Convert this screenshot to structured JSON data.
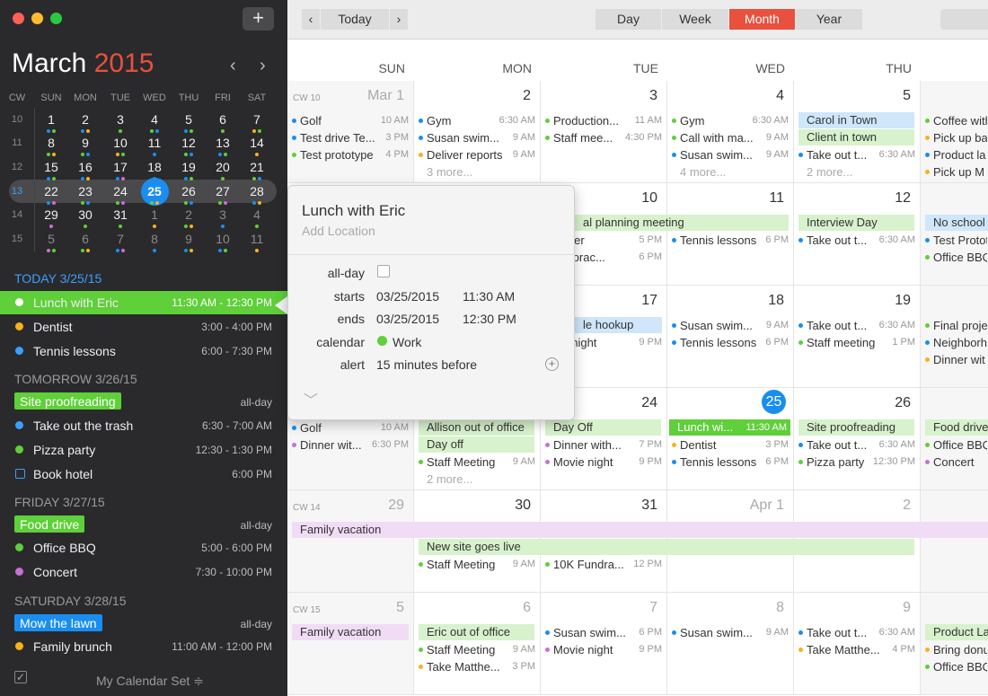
{
  "window": {
    "traffic_lights": [
      "#ff5f57",
      "#ffbd2e",
      "#28c940"
    ],
    "add_label": "+"
  },
  "mini": {
    "month": "March",
    "year": "2015",
    "headers": [
      "CW",
      "SUN",
      "MON",
      "TUE",
      "WED",
      "THU",
      "FRI",
      "SAT"
    ],
    "weeks": [
      {
        "cw": "10",
        "days": [
          "1",
          "2",
          "3",
          "4",
          "5",
          "6",
          "7"
        ]
      },
      {
        "cw": "11",
        "days": [
          "8",
          "9",
          "10",
          "11",
          "12",
          "13",
          "14"
        ]
      },
      {
        "cw": "12",
        "days": [
          "15",
          "16",
          "17",
          "18",
          "19",
          "20",
          "21"
        ]
      },
      {
        "cw": "13",
        "days": [
          "22",
          "23",
          "24",
          "25",
          "26",
          "27",
          "28"
        ]
      },
      {
        "cw": "14",
        "days": [
          "29",
          "30",
          "31",
          "1",
          "2",
          "3",
          "4"
        ]
      },
      {
        "cw": "15",
        "days": [
          "5",
          "6",
          "7",
          "8",
          "9",
          "10",
          "11"
        ]
      }
    ]
  },
  "agenda": {
    "today_header": "TODAY 3/25/15",
    "today": [
      {
        "name": "Lunch with Eric",
        "time": "11:30 AM - 12:30 PM",
        "color": "#5fcf3a"
      },
      {
        "name": "Dentist",
        "time": "3:00 - 4:00 PM",
        "color": "#f7b21c"
      },
      {
        "name": "Tennis lessons",
        "time": "6:00 - 7:30 PM",
        "color": "#3aa0ff"
      }
    ],
    "tomorrow_header": "TOMORROW 3/26/15",
    "tomorrow_allday": "Site proofreading",
    "tomorrow": [
      {
        "name": "Take out the trash",
        "time": "6:30 - 7:00 AM",
        "color": "#3aa0ff"
      },
      {
        "name": "Pizza party",
        "time": "12:30 - 1:30 PM",
        "color": "#5fcf3a"
      },
      {
        "name": "Book hotel",
        "time": "6:00 PM",
        "color": "#3aa0ff"
      }
    ],
    "friday_header": "FRIDAY 3/27/15",
    "friday_allday": "Food drive",
    "friday": [
      {
        "name": "Office BBQ",
        "time": "5:00 - 6:00 PM",
        "color": "#5fcf3a"
      },
      {
        "name": "Concert",
        "time": "7:30 - 10:00 PM",
        "color": "#c86fd8"
      }
    ],
    "saturday_header": "SATURDAY 3/28/15",
    "saturday_allday": "Mow the lawn",
    "saturday": [
      {
        "name": "Family brunch",
        "time": "11:00 AM - 12:00 PM",
        "color": "#f7b21c"
      }
    ],
    "allday_label": "all-day",
    "calendar_set": "My Calendar Set ≑",
    "check_glyph": "✓"
  },
  "toolbar": {
    "prev": "‹",
    "today": "Today",
    "next": "›",
    "views": [
      "Day",
      "Week",
      "Month",
      "Year"
    ],
    "active": "Month"
  },
  "month": {
    "dow": [
      "SUN",
      "MON",
      "TUE",
      "WED",
      "THU"
    ],
    "w1": {
      "cw": "CW 10",
      "nums": [
        "Mar 1",
        "2",
        "3",
        "4",
        "5"
      ]
    },
    "w2": {
      "nums": [
        "10",
        "11",
        "12"
      ]
    },
    "w3": {
      "nums": [
        "17",
        "18",
        "19"
      ]
    },
    "w4": {
      "nums": [
        "24",
        "25",
        "26"
      ]
    },
    "w5": {
      "cw": "CW 14",
      "nums": [
        "29",
        "30",
        "31",
        "Apr 1",
        "2"
      ]
    },
    "w6": {
      "cw": "CW 15",
      "nums": [
        "5",
        "6",
        "7",
        "8",
        "9"
      ]
    },
    "ev": {
      "golf": "Golf",
      "golf_t": "10 AM",
      "testdrive": "Test drive Te...",
      "testdrive_t": "3 PM",
      "testproto": "Test prototype",
      "testproto_t": "4 PM",
      "gym1": "Gym",
      "gym1_t": "6:30 AM",
      "susan1": "Susan swim...",
      "susan1_t": "9 AM",
      "deliver": "Deliver reports",
      "deliver_t": "9 AM",
      "more3": "3 more...",
      "production": "Production...",
      "production_t": "11 AM",
      "staffmee": "Staff mee...",
      "staffmee_t": "4:30 PM",
      "gym2": "Gym",
      "gym2_t": "6:30 AM",
      "callwith": "Call with ma...",
      "callwith_t": "9 AM",
      "susan2": "Susan swim...",
      "susan2_t": "9 AM",
      "more4": "4 more...",
      "carol": "Carol in Town",
      "client": "Client in town",
      "takeout1": "Take out t...",
      "takeout1_t": "6:30 AM",
      "more2": "2 more...",
      "coffee": "Coffee with",
      "pickup1": "Pick up ba",
      "productla": "Product la",
      "pickupm": "Pick up M",
      "planning": "al planning meeting",
      "sitter": "ysitter",
      "sitter_t": "5 PM",
      "soccer": "cer prac...",
      "soccer_t": "6 PM",
      "tennis1": "Tennis lessons",
      "tennis1_t": "6 PM",
      "interview": "Interview Day",
      "takeout2": "Take out t...",
      "takeout2_t": "6:30 AM",
      "noschool": "No school",
      "testproto2": "Test Protot",
      "officebbq1": "Office BBQ",
      "hookup": "le hookup",
      "movienight1": "vie night",
      "movienight1_t": "9 PM",
      "susan3": "Susan swim...",
      "susan3_t": "9 AM",
      "tennis2": "Tennis lessons",
      "tennis2_t": "6 PM",
      "takeout3": "Take out t...",
      "takeout3_t": "6:30 AM",
      "staffmeeting1": "Staff meeting",
      "staffmeeting1_t": "1 PM",
      "finalproj": "Final proje",
      "neighbor": "Neighborh",
      "dinnerwit": "Dinner wit",
      "golf2": "Golf",
      "golf2_t": "10 AM",
      "dinnerwit2": "Dinner wit...",
      "dinnerwit2_t": "6:30 PM",
      "allison": "Allison out of office",
      "dayoff1": "Day off",
      "staffmeet2": "Staff Meeting",
      "staffmeet2_t": "9 AM",
      "more2b": "2 more...",
      "dayoff2": "Day Off",
      "dinnerwith": "Dinner with...",
      "dinnerwith_t": "7 PM",
      "movie2": "Movie night",
      "movie2_t": "9 PM",
      "lunchwi": "Lunch wi...",
      "lunchwi_t": "11:30 AM",
      "dentist": "Dentist",
      "dentist_t": "3 PM",
      "tennis3": "Tennis lessons",
      "tennis3_t": "6 PM",
      "siteproof": "Site proofreading",
      "takeout4": "Take out t...",
      "takeout4_t": "6:30 AM",
      "pizza": "Pizza party",
      "pizza_t": "12:30 PM",
      "fooddrive": "Food drive",
      "officebbq2": "Office BBQ",
      "concert": "Concert",
      "familyvac": "Family vacation",
      "newsite": "New site goes live",
      "staffmeet3": "Staff Meeting",
      "staffmeet3_t": "9 AM",
      "tenk": "10K Fundra...",
      "tenk_t": "12 PM",
      "familyvac2": "Family vacation",
      "eric_out": "Eric out of office",
      "staffmeet4": "Staff Meeting",
      "staffmeet4_t": "9 AM",
      "takematt1": "Take Matthe...",
      "takematt1_t": "3 PM",
      "susan4": "Susan swim...",
      "susan4_t": "6 PM",
      "movie3": "Movie night",
      "movie3_t": "9 PM",
      "susan5": "Susan swim...",
      "susan5_t": "9 AM",
      "takeout5": "Take out t...",
      "takeout5_t": "6:30 AM",
      "takematt2": "Take Matthe...",
      "takematt2_t": "4 PM",
      "productla2": "Product La",
      "bringdon": "Bring donu",
      "officebbq3": "Office BBQ"
    }
  },
  "popover": {
    "title": "Lunch with Eric",
    "location_placeholder": "Add Location",
    "labels": {
      "allday": "all-day",
      "starts": "starts",
      "ends": "ends",
      "calendar": "calendar",
      "alert": "alert"
    },
    "starts_date": "03/25/2015",
    "starts_time": "11:30 AM",
    "ends_date": "03/25/2015",
    "ends_time": "12:30 PM",
    "calendar": "Work",
    "alert": "15 minutes before",
    "plus": "+",
    "chevron": "﹀"
  },
  "colors": {
    "accent": "#e9503d",
    "blue": "#1a8ef0",
    "green": "#5fcf3a",
    "yellow": "#f7b21c",
    "purple": "#c86fd8",
    "light_green": "#d7f2cc",
    "light_blue": "#cfe6fb",
    "light_purple": "#f1dcf5"
  }
}
